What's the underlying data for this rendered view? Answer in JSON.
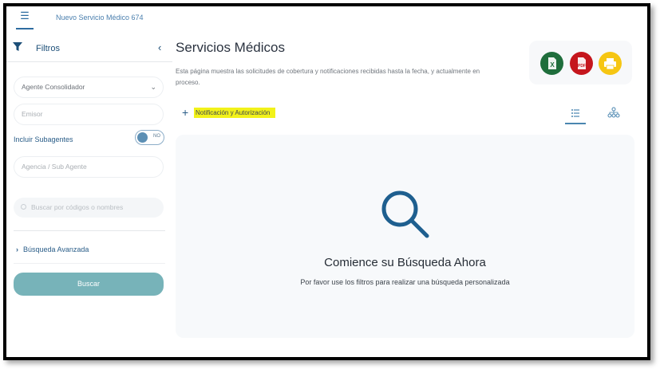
{
  "header": {
    "menu_icon": "hamburger-icon",
    "app_title": "Nuevo Servicio Médico 674"
  },
  "sidebar": {
    "title": "Filtros",
    "title_icon": "filter-icon",
    "collapse_icon": "chevron-left-icon",
    "agente_select": "Agente Consolidador",
    "emisor_placeholder": "Emisor",
    "subagentes_label": "Incluir Subagentes",
    "subagentes_toggle": "NO",
    "agencia_placeholder": "Agencia / Sub Agente",
    "search_placeholder": "Buscar por códigos o nombres",
    "advanced_label": "Búsqueda Avanzada",
    "search_button": "Buscar"
  },
  "main": {
    "title": "Servicios Médicos",
    "description": "Esta página muestra las solicitudes de cobertura y notificaciones recibidas hasta la fecha, y actualmente en proceso.",
    "export_icons": [
      "excel-icon",
      "pdf-icon",
      "print-icon"
    ],
    "excel_letter": "X",
    "pdf_letter": "PDF",
    "notif_label": "Notificación y Autorización",
    "views": [
      "list-view-icon",
      "tree-view-icon"
    ],
    "empty_title": "Comience su Búsqueda Ahora",
    "empty_subtitle": "Por favor use los filtros para realizar una búsqueda personalizada"
  },
  "colors": {
    "accent": "#2d6ca0",
    "search_button": "#77b3b9",
    "excel": "#1f6e3c",
    "pdf": "#c5161d",
    "print": "#f6c613",
    "highlight": "#f2f21a"
  }
}
